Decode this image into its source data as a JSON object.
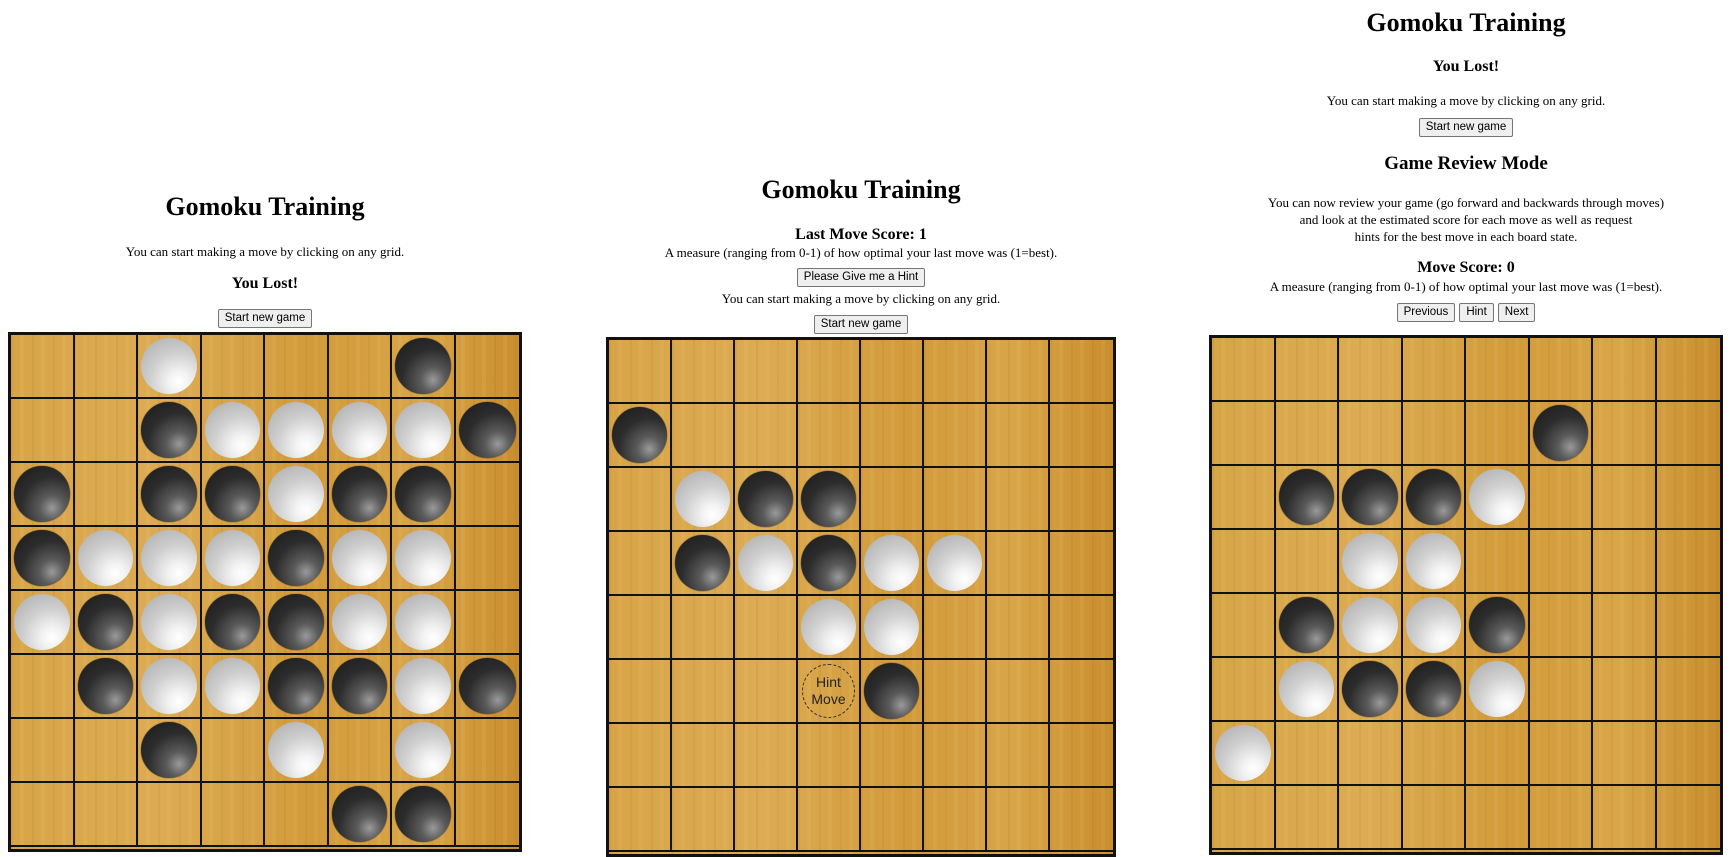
{
  "panels": [
    {
      "title": "Gomoku Training",
      "instruction": "You can start making a move by clicking on any grid.",
      "status": "You Lost!",
      "new_game_label": "Start new game",
      "board": [
        "..W...B.",
        "..BWWWWB",
        "B.BBWBB.",
        "BWWWBWW.",
        "WBWBBWW.",
        ".BWWBBWB",
        "..B.W.W.",
        ".....BB."
      ]
    },
    {
      "title": "Gomoku Training",
      "score_label": "Last Move Score: 1",
      "score_desc": "A measure (ranging from 0-1) of how optimal your last move was (1=best).",
      "hint_button_label": "Please Give me a Hint",
      "instruction": "You can start making a move by clicking on any grid.",
      "new_game_label": "Start new game",
      "hint_text": "Hint Move",
      "board": [
        "........",
        "B.......",
        ".WBB....",
        ".BWBWW..",
        "...WW...",
        "...HB...",
        "........",
        "........"
      ]
    },
    {
      "title": "Gomoku Training",
      "status": "You Lost!",
      "instruction": "You can start making a move by clicking on any grid.",
      "new_game_label": "Start new game",
      "review_title": "Game Review Mode",
      "review_desc": [
        "You can now review your game (go forward and backwards through moves)",
        "and look at the estimated score for each move as well as request",
        "hints for the best move in each board state."
      ],
      "score_label": "Move Score: 0",
      "score_desc": "A measure (ranging from 0-1) of how optimal your last move was (1=best).",
      "previous_label": "Previous",
      "hint_label": "Hint",
      "next_label": "Next",
      "board": [
        "........",
        ".....B..",
        ".BBBW...",
        "..WW....",
        ".BWWB...",
        ".WBBW...",
        "W.......",
        "........"
      ]
    }
  ],
  "colors": {
    "board_wood": "#d8a447",
    "grid_line": "#111111",
    "black_stone": "#2c2c2c",
    "white_stone": "#d0d0d0"
  }
}
